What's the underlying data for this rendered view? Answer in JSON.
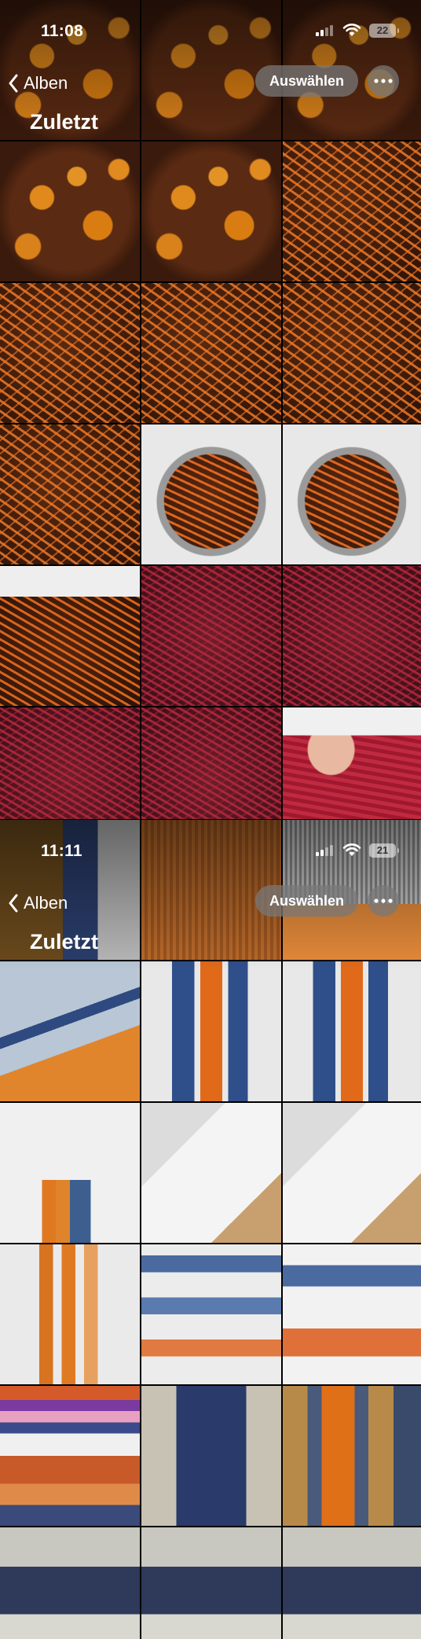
{
  "screens": [
    {
      "status": {
        "time": "11:08",
        "battery": "22"
      },
      "nav": {
        "back_label": "Alben",
        "select_label": "Auswählen"
      },
      "title": "Zuletzt",
      "tiles": [
        "dye-pot-orange-blobs",
        "dye-pot-orange-blobs",
        "dye-pot-orange-blobs",
        "dye-pot-orange-blobs",
        "dye-pot-orange-blobs",
        "dye-bath-orange-yarn",
        "dye-bath-orange-yarn",
        "dye-bath-orange-yarn",
        "dye-bath-orange-yarn",
        "dye-bath-orange-yarn",
        "pot-orange-yarn",
        "pot-orange-yarn",
        "pot-orange-yarn-papers",
        "red-yarn-in-pot",
        "red-yarn-in-pot",
        "red-yarn-in-pot",
        "red-yarn-in-pot",
        "hand-holding-red-yarn"
      ]
    },
    {
      "status": {
        "time": "11:11",
        "battery": "21"
      },
      "nav": {
        "back_label": "Alben",
        "select_label": "Auswählen"
      },
      "title": "Zuletzt",
      "tiles": [
        "woven-sample-blue",
        "woven-sample-orange",
        "woven-sample-orange-blue",
        "woven-sample-diagonal",
        "yarn-bobbins-blue-orange",
        "yarn-bobbins-blue-orange",
        "yarn-bobbins-sketch",
        "sketchbook-table",
        "sketchbook-table",
        "orange-bobbins",
        "weave-drafts-colored",
        "weave-sketch",
        "woven-stripes-colorful",
        "woven-grey-blue",
        "shuttle-orange",
        "woven-blue-white",
        "woven-blue-white",
        "woven-blue-white"
      ]
    }
  ]
}
